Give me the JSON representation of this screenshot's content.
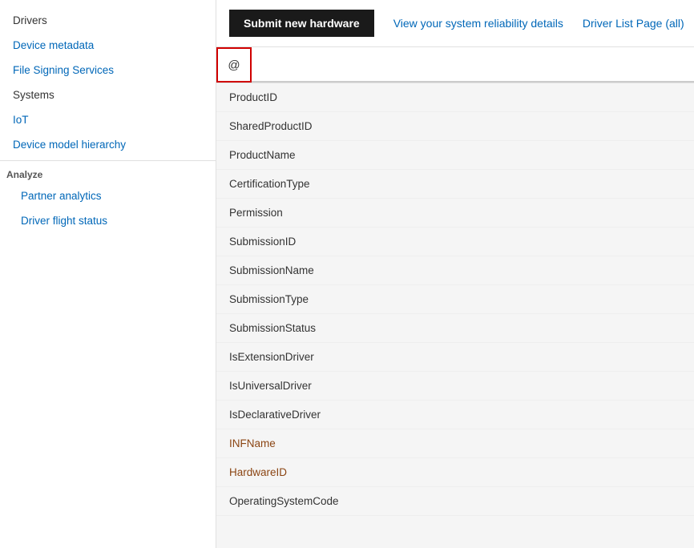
{
  "sidebar": {
    "items": [
      {
        "label": "Drivers",
        "type": "plain",
        "indented": false
      },
      {
        "label": "Device metadata",
        "type": "link",
        "indented": false
      },
      {
        "label": "File Signing Services",
        "type": "link",
        "indented": false
      },
      {
        "label": "Systems",
        "type": "plain",
        "indented": false
      },
      {
        "label": "IoT",
        "type": "link",
        "indented": false
      },
      {
        "label": "Device model hierarchy",
        "type": "link",
        "indented": false
      }
    ],
    "analyze_label": "Analyze",
    "analyze_items": [
      {
        "label": "Partner analytics",
        "type": "link",
        "indented": true
      },
      {
        "label": "Driver flight status",
        "type": "link",
        "indented": true
      }
    ]
  },
  "toolbar": {
    "submit_label": "Submit new hardware",
    "reliability_label": "View your system reliability details",
    "driver_list_label": "Driver List Page (all)"
  },
  "filter": {
    "icon": "@",
    "placeholder": ""
  },
  "list_items": [
    {
      "text": "ProductID",
      "style": "plain"
    },
    {
      "text": "SharedProductID",
      "style": "plain"
    },
    {
      "text": "ProductName",
      "style": "plain"
    },
    {
      "text": "CertificationType",
      "style": "plain"
    },
    {
      "text": "Permission",
      "style": "plain"
    },
    {
      "text": "SubmissionID",
      "style": "plain"
    },
    {
      "text": "SubmissionName",
      "style": "plain"
    },
    {
      "text": "SubmissionType",
      "style": "plain"
    },
    {
      "text": "SubmissionStatus",
      "style": "plain"
    },
    {
      "text": "IsExtensionDriver",
      "style": "plain"
    },
    {
      "text": "IsUniversalDriver",
      "style": "plain"
    },
    {
      "text": "IsDeclarativeDriver",
      "style": "plain"
    },
    {
      "text": "INFName",
      "style": "brown"
    },
    {
      "text": "HardwareID",
      "style": "brown"
    },
    {
      "text": "OperatingSystemCode",
      "style": "plain"
    }
  ]
}
